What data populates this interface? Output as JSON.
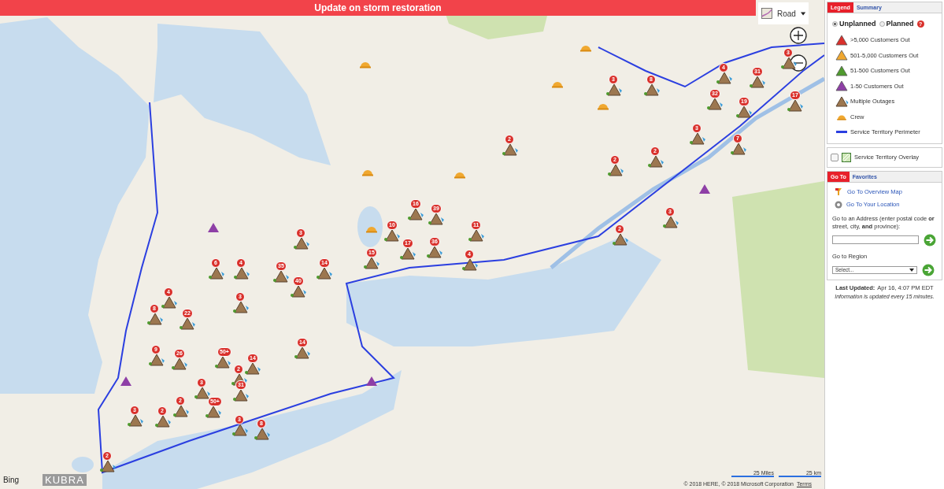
{
  "banner": {
    "text": "Update on storm restoration"
  },
  "map": {
    "map_type": "Road",
    "outages": [
      {
        "kind": "multiple",
        "count": "3"
      },
      {
        "kind": "multiple",
        "count": "8"
      },
      {
        "kind": "multiple",
        "count": "4"
      },
      {
        "kind": "multiple",
        "count": "31"
      },
      {
        "kind": "multiple",
        "count": "3"
      },
      {
        "kind": "multiple",
        "count": "32"
      },
      {
        "kind": "multiple",
        "count": "19"
      },
      {
        "kind": "multiple",
        "count": "17"
      },
      {
        "kind": "multiple",
        "count": "3"
      },
      {
        "kind": "multiple",
        "count": "7"
      },
      {
        "kind": "multiple",
        "count": "2"
      },
      {
        "kind": "multiple",
        "count": "2"
      },
      {
        "kind": "multiple",
        "count": "2"
      },
      {
        "kind": "multiple",
        "count": "16"
      },
      {
        "kind": "multiple",
        "count": "39"
      },
      {
        "kind": "multiple",
        "count": "11"
      },
      {
        "kind": "multiple",
        "count": "10"
      },
      {
        "kind": "multiple",
        "count": "3"
      },
      {
        "kind": "multiple",
        "count": "2"
      },
      {
        "kind": "multiple",
        "count": "3"
      },
      {
        "kind": "multiple",
        "count": "15"
      },
      {
        "kind": "multiple",
        "count": "17"
      },
      {
        "kind": "multiple",
        "count": "36"
      },
      {
        "kind": "multiple",
        "count": "4"
      },
      {
        "kind": "multiple",
        "count": "6"
      },
      {
        "kind": "multiple",
        "count": "4"
      },
      {
        "kind": "multiple",
        "count": "35"
      },
      {
        "kind": "multiple",
        "count": "14"
      },
      {
        "kind": "multiple",
        "count": "40"
      },
      {
        "kind": "multiple",
        "count": "4"
      },
      {
        "kind": "multiple",
        "count": "3"
      },
      {
        "kind": "multiple",
        "count": "8"
      },
      {
        "kind": "multiple",
        "count": "22"
      },
      {
        "kind": "multiple",
        "count": "14"
      },
      {
        "kind": "multiple",
        "count": "9"
      },
      {
        "kind": "multiple",
        "count": "26"
      },
      {
        "kind": "multiple",
        "count": "50+"
      },
      {
        "kind": "multiple",
        "count": "14"
      },
      {
        "kind": "multiple",
        "count": "2"
      },
      {
        "kind": "multiple",
        "count": "31"
      },
      {
        "kind": "multiple",
        "count": "3"
      },
      {
        "kind": "multiple",
        "count": "2"
      },
      {
        "kind": "multiple",
        "count": "3"
      },
      {
        "kind": "multiple",
        "count": "2"
      },
      {
        "kind": "multiple",
        "count": "50+"
      },
      {
        "kind": "multiple",
        "count": "3"
      },
      {
        "kind": "multiple",
        "count": "8"
      },
      {
        "kind": "multiple",
        "count": "2"
      },
      {
        "kind": "single",
        "color": "#8e3fa6"
      },
      {
        "kind": "single",
        "color": "#8e3fa6"
      },
      {
        "kind": "single",
        "color": "#8e3fa6"
      },
      {
        "kind": "single",
        "color": "#8e3fa6"
      },
      {
        "kind": "crew"
      },
      {
        "kind": "crew"
      },
      {
        "kind": "crew"
      },
      {
        "kind": "crew"
      },
      {
        "kind": "crew"
      },
      {
        "kind": "crew"
      },
      {
        "kind": "crew"
      }
    ],
    "scale": [
      "25 Miles",
      "25 km"
    ],
    "attribution": "© 2018 HERE, © 2018 Microsoft Corporation",
    "terms": "Terms",
    "logos": [
      "Bing",
      "KUBRA"
    ]
  },
  "legend_panel": {
    "tabs": [
      {
        "label": "Legend",
        "selected": true
      },
      {
        "label": "Summary",
        "selected": false
      }
    ],
    "modes": [
      {
        "label": "Unplanned",
        "selected": true
      },
      {
        "label": "Planned",
        "selected": false
      }
    ],
    "help": "?",
    "items": [
      {
        "kind": "triangle",
        "color": "#d9302b",
        "label": ">5,000 Customers Out"
      },
      {
        "kind": "triangle",
        "color": "#f0a830",
        "label": "501-5,000 Customers Out"
      },
      {
        "kind": "triangle",
        "color": "#4f9a2e",
        "label": "51-500 Customers Out"
      },
      {
        "kind": "triangle",
        "color": "#8e3fa6",
        "label": "1-50 Customers Out"
      },
      {
        "kind": "multiple",
        "label": "Multiple Outages"
      },
      {
        "kind": "crew",
        "label": "Crew"
      },
      {
        "kind": "line",
        "color": "#2b3fe0",
        "label": "Service Territory Perimeter"
      }
    ]
  },
  "overlay": {
    "label": "Service Territory Overlay",
    "checked": false
  },
  "goto_panel": {
    "tabs": [
      {
        "label": "Go To",
        "selected": true
      },
      {
        "label": "Favorites",
        "selected": false
      }
    ],
    "links": [
      {
        "kind": "overview",
        "label": "Go To Overview Map"
      },
      {
        "kind": "location",
        "label": "Go To Your Location"
      }
    ],
    "address_label": "Go to an Address (enter postal code **or** street, city, **and** province):",
    "region_label": "Go to Region",
    "region_select": "Select..."
  },
  "last_updated": {
    "label": "Last Updated:",
    "value": "Apr 16, 4:07 PM EDT"
  },
  "note": "Information is updated every 15 minutes."
}
